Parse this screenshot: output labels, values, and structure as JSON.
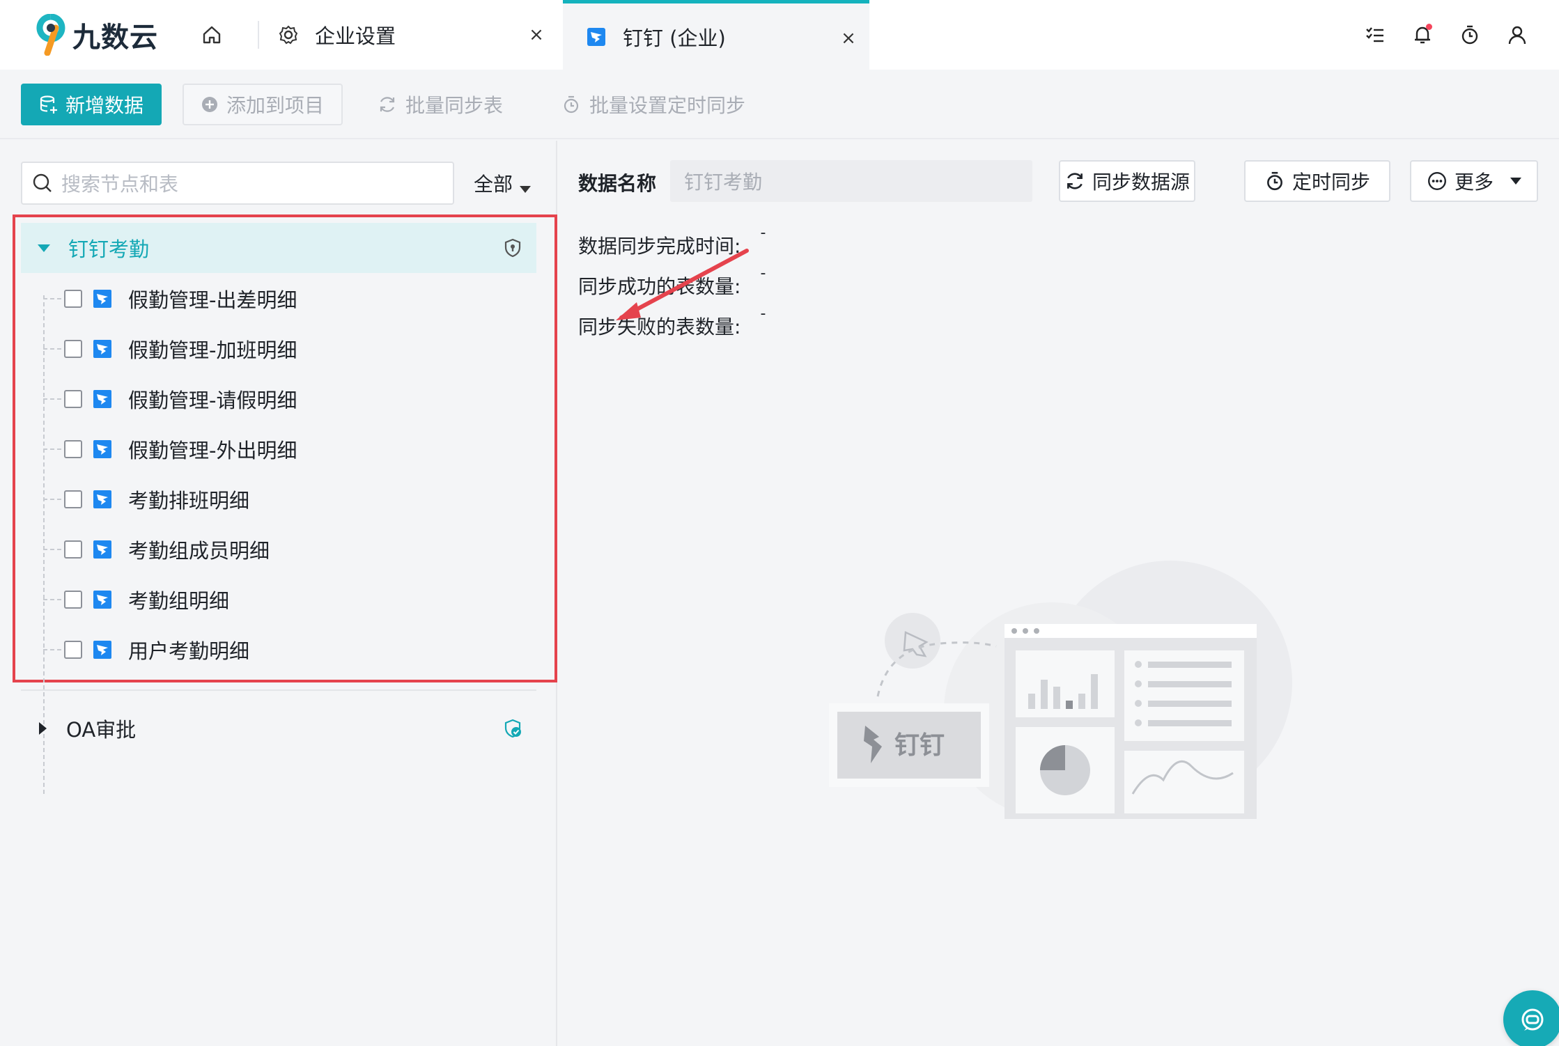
{
  "app": {
    "logo_text": "九数云"
  },
  "tabs": [
    {
      "label": "企业设置",
      "icon": "gear-icon",
      "close": "×"
    },
    {
      "label": "钉钉 (企业)",
      "icon": "dingtalk-icon",
      "close": "×",
      "active": true
    }
  ],
  "toolbar": {
    "new_data": "新增数据",
    "add_to_project": "添加到项目",
    "batch_sync": "批量同步表",
    "batch_timer": "批量设置定时同步"
  },
  "sidebar": {
    "search_placeholder": "搜索节点和表",
    "filter": "全部",
    "groups": [
      {
        "label": "钉钉考勤",
        "expanded": true,
        "items": [
          "假勤管理-出差明细",
          "假勤管理-加班明细",
          "假勤管理-请假明细",
          "假勤管理-外出明细",
          "考勤排班明细",
          "考勤组成员明细",
          "考勤组明细",
          "用户考勤明细"
        ]
      },
      {
        "label": "OA审批",
        "expanded": false
      }
    ]
  },
  "detail": {
    "name_label": "数据名称",
    "name_value": "钉钉考勤",
    "sync_source_btn": "同步数据源",
    "timer_sync_btn": "定时同步",
    "more_btn": "更多",
    "rows": [
      {
        "label": "数据同步完成时间:",
        "value": "-"
      },
      {
        "label": "同步成功的表数量:",
        "value": "-"
      },
      {
        "label": "同步失败的表数量:",
        "value": "-"
      }
    ],
    "illustration_text": "钉钉"
  },
  "colors": {
    "accent": "#14a8b5",
    "highlight_border": "#e5434d",
    "ding_blue": "#1e88f0"
  }
}
